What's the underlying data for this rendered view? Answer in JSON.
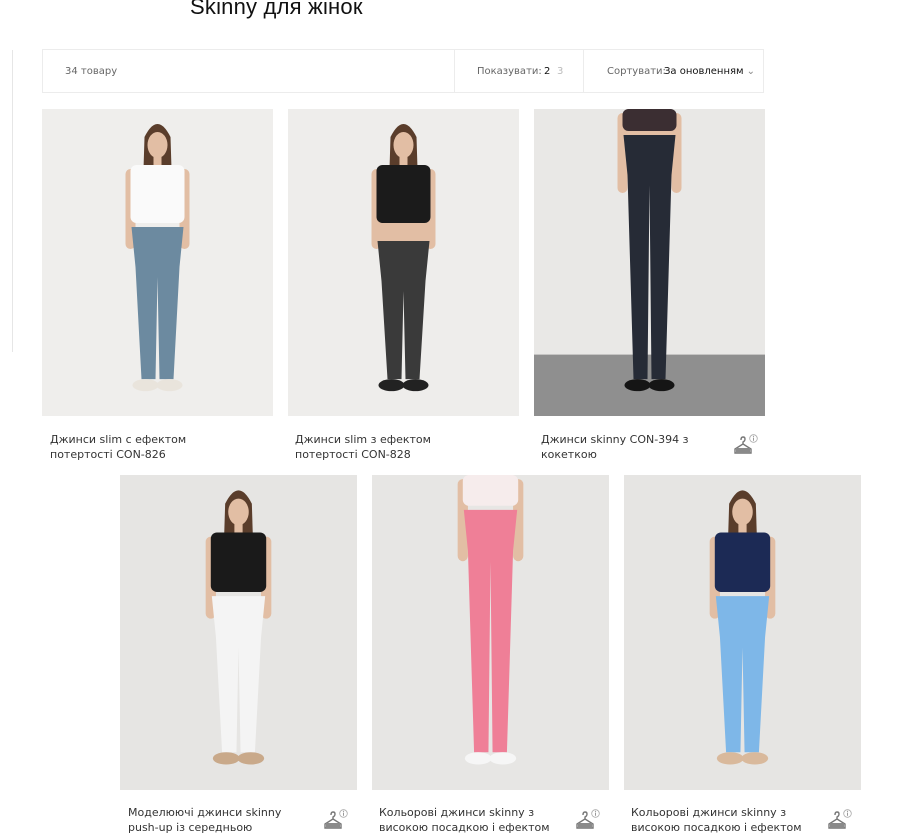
{
  "page": {
    "title": "Skinny для жінок"
  },
  "toolbar": {
    "count": "34 товару",
    "show_label": "Показувати:",
    "show_options": [
      "2",
      "3"
    ],
    "sort_label": "Сортувати:",
    "sort_value": "За оновленням",
    "sort_caret": "⌄"
  },
  "products": [
    {
      "name": "Джинси slim с ефектом потертості CON-826",
      "jeans_color": "#6c8aa0",
      "top_color": "#fafafa",
      "background": "#efeeec",
      "shoe_color": "#e9e4dc",
      "wishlist": false
    },
    {
      "name": "Джинси slim з ефектом потертості CON-828",
      "jeans_color": "#3a3a3a",
      "top_color": "#1b1b1b",
      "background": "#eeedeb",
      "shoe_color": "#222222",
      "wishlist": false
    },
    {
      "name": "Джинси skinny CON-394 з кокеткою",
      "jeans_color": "#262b36",
      "top_color": "#3b2e32",
      "background": "#e9e8e6",
      "shoe_color": "#151515",
      "wishlist": true
    },
    {
      "name": "Моделюючі джинси skinny push-up із середньою",
      "jeans_color": "#f4f4f4",
      "top_color": "#1a1a1a",
      "background": "#e6e5e3",
      "shoe_color": "#c9a98a",
      "wishlist": true
    },
    {
      "name": "Кольорові джинси skinny з високою посадкою і ефектом",
      "jeans_color": "#ef7f97",
      "top_color": "#f6ecec",
      "background": "#e7e6e4",
      "shoe_color": "#f6f6f6",
      "wishlist": true
    },
    {
      "name": "Кольорові джинси skinny з високою посадкою і ефектом",
      "jeans_color": "#7eb7e8",
      "top_color": "#1c2a55",
      "background": "#e6e5e3",
      "shoe_color": "#d9b99c",
      "wishlist": true
    }
  ]
}
